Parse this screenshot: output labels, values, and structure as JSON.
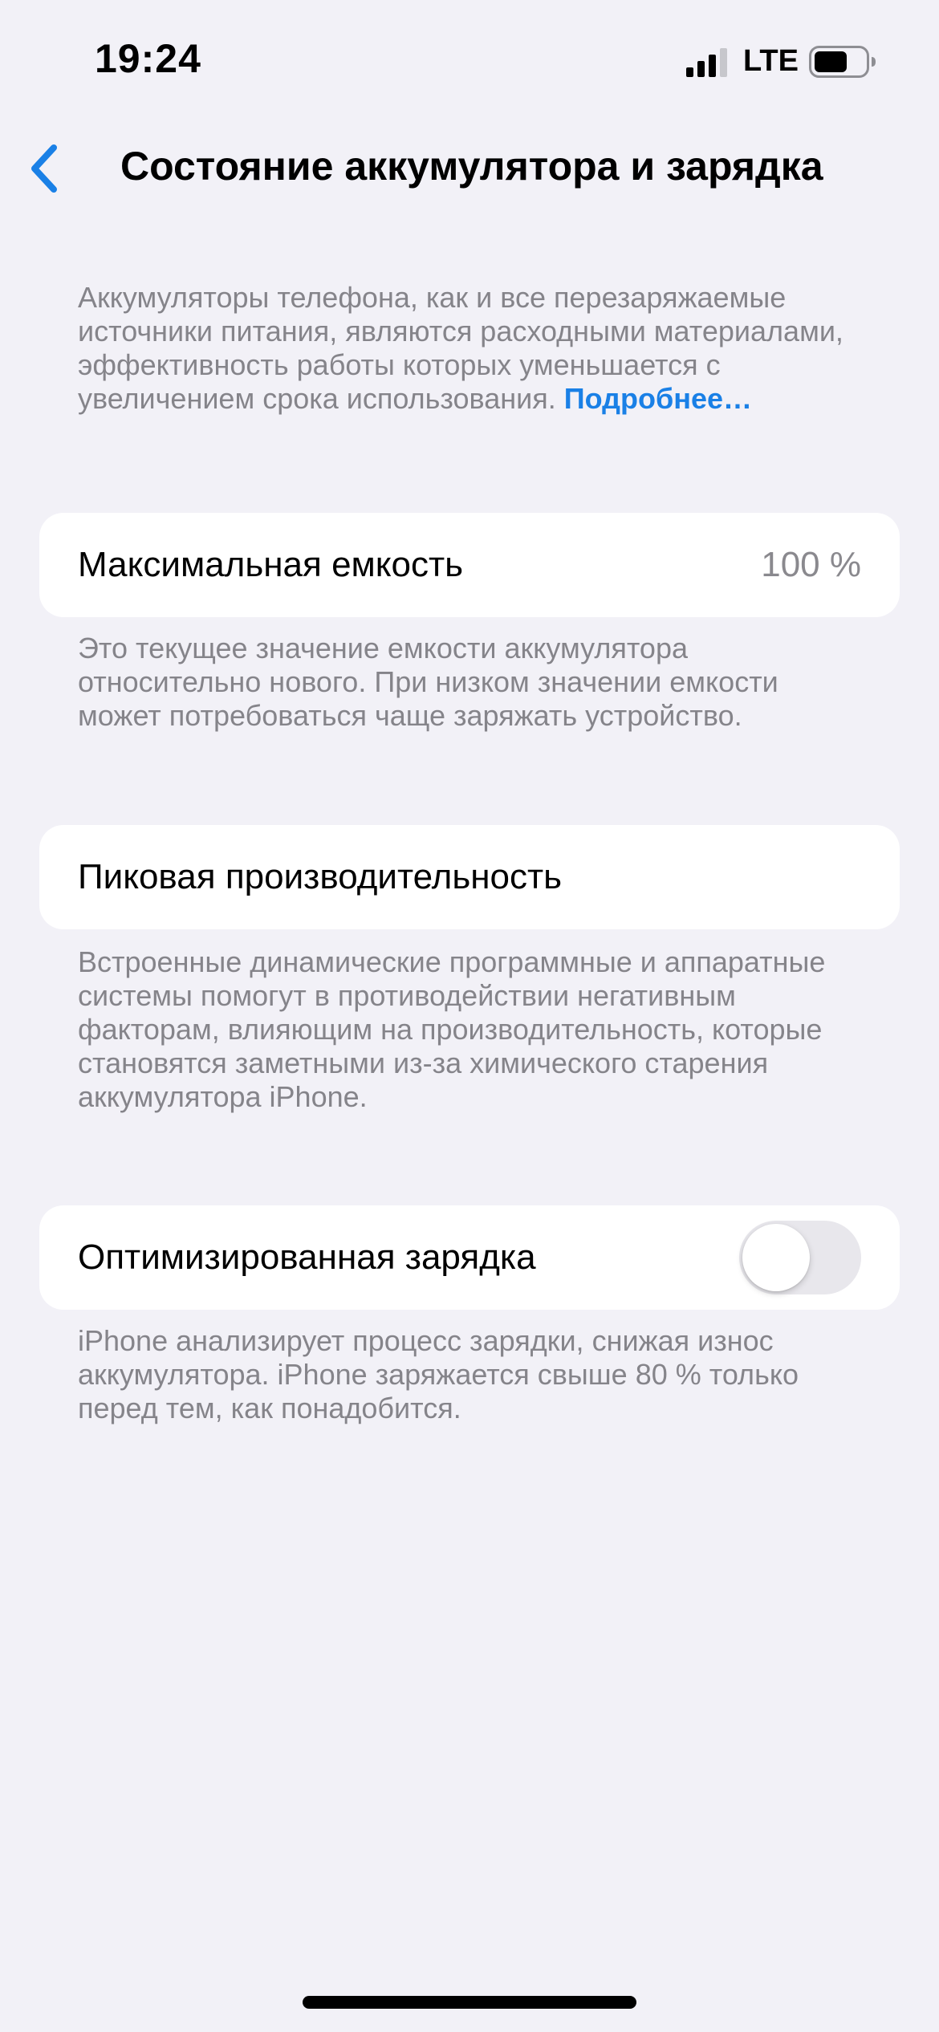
{
  "status_bar": {
    "time": "19:24",
    "network": "LTE",
    "icons": [
      "signal-icon",
      "battery-icon"
    ]
  },
  "nav": {
    "title": "Состояние аккумулятора и зарядка",
    "back_icon": "chevron-left-icon"
  },
  "intro": {
    "text": "Аккумуляторы телефона, как и все перезаряжаемые источники питания, являются расходными материалами, эффективность работы которых уменьшается с увеличением срока использования.",
    "link": "Подробнее…"
  },
  "max_capacity": {
    "label": "Максимальная емкость",
    "value": "100 %",
    "footer": "Это текущее значение емкости аккумулятора относительно нового. При низком значении емкости может потребоваться чаще заряжать устройство."
  },
  "peak_performance": {
    "label": "Пиковая производительность",
    "footer": "Встроенные динамические программные и аппаратные системы помогут в противодействии негативным факторам, влияющим на производительность, которые становятся заметными из-за химического старения аккумулятора iPhone."
  },
  "optimized_charging": {
    "label": "Оптимизированная зарядка",
    "enabled": false,
    "footer": "iPhone анализирует процесс зарядки, снижая износ аккумулятора. iPhone заряжается свыше 80 % только перед тем, как понадобится."
  },
  "colors": {
    "background": "#f2f1f7",
    "accent": "#1a80e6",
    "secondary_text": "#85848a"
  }
}
